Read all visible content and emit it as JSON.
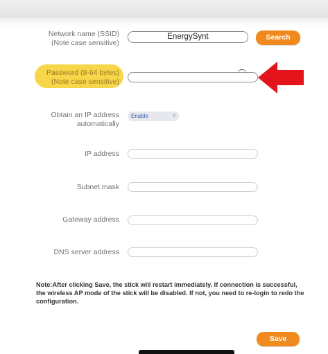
{
  "form": {
    "ssid": {
      "label_line1": "Network name (SSID)",
      "label_line2": "(Note case sensitive)",
      "value": "EnergySynt",
      "search_label": "Search"
    },
    "password": {
      "label_line1": "Password (8-64 bytes)",
      "label_line2": "(Note case sensitive)",
      "value": ""
    },
    "dhcp": {
      "label_line1": "Obtain an IP address",
      "label_line2": "automatically",
      "selected": "Enable"
    },
    "ip_address": {
      "label": "IP address",
      "value": ""
    },
    "subnet_mask": {
      "label": "Subnet mask",
      "value": ""
    },
    "gateway_address": {
      "label": "Gateway address",
      "value": ""
    },
    "dns_server_address": {
      "label": "DNS server address",
      "value": ""
    }
  },
  "note": "Note:After clicking Save, the stick will restart immediately. If connection is successful, the wireless AP mode of the stick will be disabled. If not, you need to re-login to redo the configuration.",
  "save_label": "Save",
  "colors": {
    "accent_orange": "#f08a1e",
    "highlight_yellow": "#f7d64a",
    "arrow_red": "#e3141b"
  },
  "icons": {
    "arrow": "red-arrow-pointing-left",
    "select_chevron": "up-down-chevron",
    "loading": "spinner"
  }
}
